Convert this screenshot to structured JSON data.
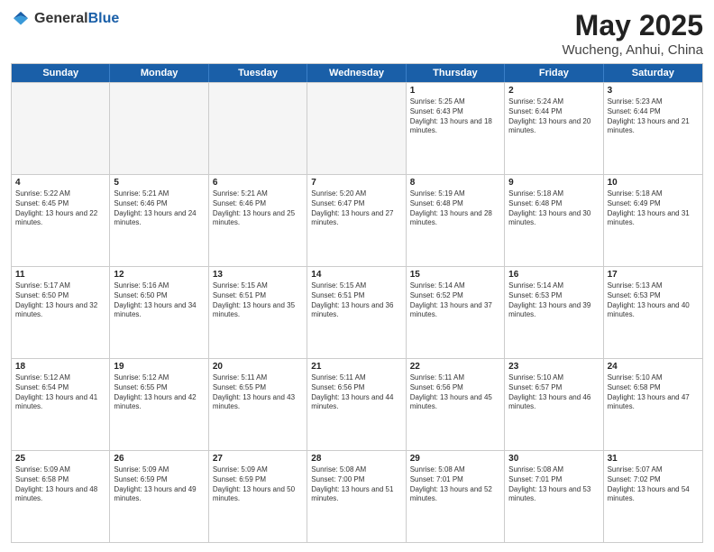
{
  "header": {
    "logo": {
      "general": "General",
      "blue": "Blue"
    },
    "title": "May 2025",
    "location": "Wucheng, Anhui, China"
  },
  "weekdays": [
    "Sunday",
    "Monday",
    "Tuesday",
    "Wednesday",
    "Thursday",
    "Friday",
    "Saturday"
  ],
  "rows": [
    [
      {
        "day": "",
        "empty": true
      },
      {
        "day": "",
        "empty": true
      },
      {
        "day": "",
        "empty": true
      },
      {
        "day": "",
        "empty": true
      },
      {
        "day": "1",
        "sunrise": "5:25 AM",
        "sunset": "6:43 PM",
        "daylight": "13 hours and 18 minutes."
      },
      {
        "day": "2",
        "sunrise": "5:24 AM",
        "sunset": "6:44 PM",
        "daylight": "13 hours and 20 minutes."
      },
      {
        "day": "3",
        "sunrise": "5:23 AM",
        "sunset": "6:44 PM",
        "daylight": "13 hours and 21 minutes."
      }
    ],
    [
      {
        "day": "4",
        "sunrise": "5:22 AM",
        "sunset": "6:45 PM",
        "daylight": "13 hours and 22 minutes."
      },
      {
        "day": "5",
        "sunrise": "5:21 AM",
        "sunset": "6:46 PM",
        "daylight": "13 hours and 24 minutes."
      },
      {
        "day": "6",
        "sunrise": "5:21 AM",
        "sunset": "6:46 PM",
        "daylight": "13 hours and 25 minutes."
      },
      {
        "day": "7",
        "sunrise": "5:20 AM",
        "sunset": "6:47 PM",
        "daylight": "13 hours and 27 minutes."
      },
      {
        "day": "8",
        "sunrise": "5:19 AM",
        "sunset": "6:48 PM",
        "daylight": "13 hours and 28 minutes."
      },
      {
        "day": "9",
        "sunrise": "5:18 AM",
        "sunset": "6:48 PM",
        "daylight": "13 hours and 30 minutes."
      },
      {
        "day": "10",
        "sunrise": "5:18 AM",
        "sunset": "6:49 PM",
        "daylight": "13 hours and 31 minutes."
      }
    ],
    [
      {
        "day": "11",
        "sunrise": "5:17 AM",
        "sunset": "6:50 PM",
        "daylight": "13 hours and 32 minutes."
      },
      {
        "day": "12",
        "sunrise": "5:16 AM",
        "sunset": "6:50 PM",
        "daylight": "13 hours and 34 minutes."
      },
      {
        "day": "13",
        "sunrise": "5:15 AM",
        "sunset": "6:51 PM",
        "daylight": "13 hours and 35 minutes."
      },
      {
        "day": "14",
        "sunrise": "5:15 AM",
        "sunset": "6:51 PM",
        "daylight": "13 hours and 36 minutes."
      },
      {
        "day": "15",
        "sunrise": "5:14 AM",
        "sunset": "6:52 PM",
        "daylight": "13 hours and 37 minutes."
      },
      {
        "day": "16",
        "sunrise": "5:14 AM",
        "sunset": "6:53 PM",
        "daylight": "13 hours and 39 minutes."
      },
      {
        "day": "17",
        "sunrise": "5:13 AM",
        "sunset": "6:53 PM",
        "daylight": "13 hours and 40 minutes."
      }
    ],
    [
      {
        "day": "18",
        "sunrise": "5:12 AM",
        "sunset": "6:54 PM",
        "daylight": "13 hours and 41 minutes."
      },
      {
        "day": "19",
        "sunrise": "5:12 AM",
        "sunset": "6:55 PM",
        "daylight": "13 hours and 42 minutes."
      },
      {
        "day": "20",
        "sunrise": "5:11 AM",
        "sunset": "6:55 PM",
        "daylight": "13 hours and 43 minutes."
      },
      {
        "day": "21",
        "sunrise": "5:11 AM",
        "sunset": "6:56 PM",
        "daylight": "13 hours and 44 minutes."
      },
      {
        "day": "22",
        "sunrise": "5:11 AM",
        "sunset": "6:56 PM",
        "daylight": "13 hours and 45 minutes."
      },
      {
        "day": "23",
        "sunrise": "5:10 AM",
        "sunset": "6:57 PM",
        "daylight": "13 hours and 46 minutes."
      },
      {
        "day": "24",
        "sunrise": "5:10 AM",
        "sunset": "6:58 PM",
        "daylight": "13 hours and 47 minutes."
      }
    ],
    [
      {
        "day": "25",
        "sunrise": "5:09 AM",
        "sunset": "6:58 PM",
        "daylight": "13 hours and 48 minutes."
      },
      {
        "day": "26",
        "sunrise": "5:09 AM",
        "sunset": "6:59 PM",
        "daylight": "13 hours and 49 minutes."
      },
      {
        "day": "27",
        "sunrise": "5:09 AM",
        "sunset": "6:59 PM",
        "daylight": "13 hours and 50 minutes."
      },
      {
        "day": "28",
        "sunrise": "5:08 AM",
        "sunset": "7:00 PM",
        "daylight": "13 hours and 51 minutes."
      },
      {
        "day": "29",
        "sunrise": "5:08 AM",
        "sunset": "7:01 PM",
        "daylight": "13 hours and 52 minutes."
      },
      {
        "day": "30",
        "sunrise": "5:08 AM",
        "sunset": "7:01 PM",
        "daylight": "13 hours and 53 minutes."
      },
      {
        "day": "31",
        "sunrise": "5:07 AM",
        "sunset": "7:02 PM",
        "daylight": "13 hours and 54 minutes."
      }
    ]
  ]
}
